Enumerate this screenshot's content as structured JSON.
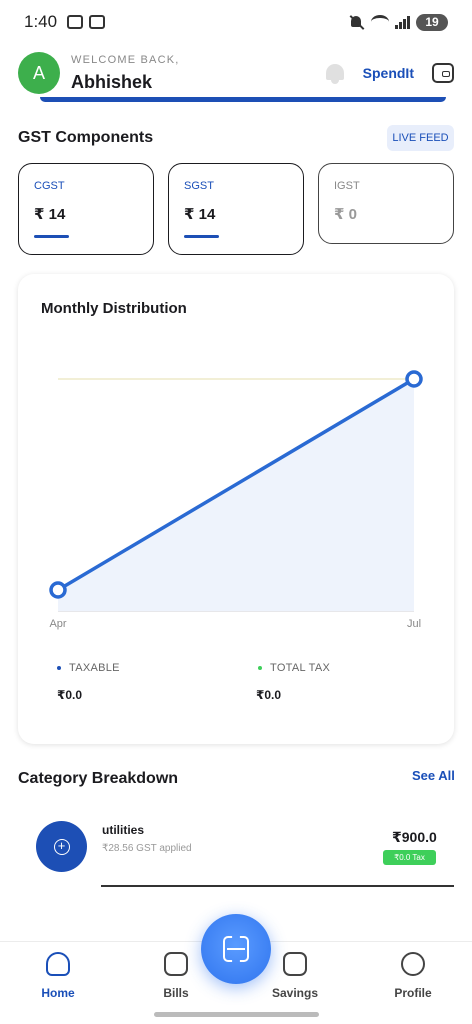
{
  "status_bar": {
    "time": "1:40",
    "battery": "19"
  },
  "header": {
    "avatar_initial": "A",
    "welcome_label": "WELCOME BACK,",
    "user_name": "Abhishek",
    "brand": "SpendIt"
  },
  "gst": {
    "title": "GST Components",
    "live_feed": "LIVE FEED",
    "cards": [
      {
        "label": "CGST",
        "value": "₹ 14"
      },
      {
        "label": "SGST",
        "value": "₹ 14"
      },
      {
        "label": "IGST",
        "value": "₹ 0"
      }
    ]
  },
  "chart": {
    "title": "Monthly Distribution",
    "legend": [
      {
        "label": "TAXABLE",
        "value": "₹0.0",
        "color": "#1d4fb5"
      },
      {
        "label": "TOTAL TAX",
        "value": "₹0.0",
        "color": "#3ecf5a"
      }
    ]
  },
  "chart_data": {
    "type": "area",
    "categories": [
      "Apr",
      "Jul"
    ],
    "series": [
      {
        "values": [
          0,
          900
        ]
      }
    ],
    "line_color": "#2a6ad3",
    "fill_color": "#eef3fc",
    "reference_line_color": "#eeeac9"
  },
  "category": {
    "title": "Category Breakdown",
    "see_all": "See All",
    "items": [
      {
        "name": "utilities",
        "sub": "₹28.56 GST applied",
        "amount": "₹900.0",
        "tax": "₹0.0 Tax"
      }
    ]
  },
  "nav": {
    "home": "Home",
    "bills": "Bills",
    "savings": "Savings",
    "profile": "Profile"
  }
}
